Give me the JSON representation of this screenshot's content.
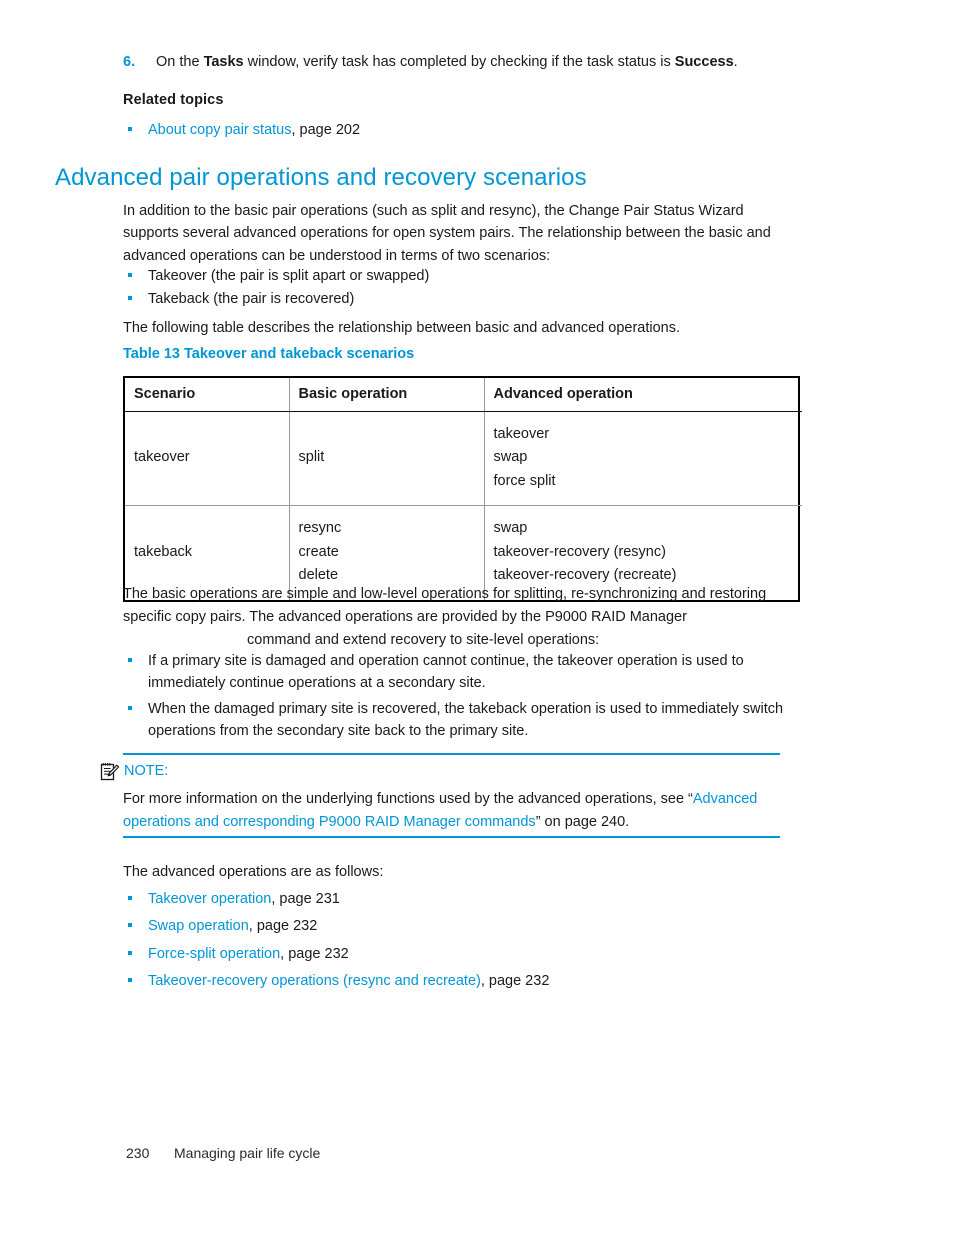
{
  "colors": {
    "accent": "#0096d6",
    "text": "#1a1a1a",
    "table_border": "#000000",
    "table_rule": "#9a9a9a"
  },
  "step": {
    "number": "6.",
    "text_before_bold1": "On the ",
    "bold1": "Tasks",
    "text_middle": " window, verify task has completed by checking if the task status is ",
    "bold2": "Success",
    "text_end": "."
  },
  "related": {
    "heading": "Related topics",
    "items": [
      {
        "link": "About copy pair status",
        "rest": ", page 202"
      }
    ]
  },
  "heading": {
    "title": "Advanced pair operations and recovery scenarios"
  },
  "intro": {
    "paragraph": "In addition to the basic pair operations (such as split and resync), the Change Pair Status Wizard supports several advanced operations for open system pairs. The relationship between the basic and advanced operations can be understood in terms of two scenarios:",
    "scenarios": [
      "Takeover (the pair is split apart or swapped)",
      "Takeback (the pair is recovered)"
    ],
    "table_lead": "The following table describes the relationship between basic and advanced operations."
  },
  "table": {
    "caption_number": "Table 13",
    "caption_title": "Takeover and takeback scenarios",
    "caption_full": "Table 13 Takeover and takeback scenarios",
    "headers": [
      "Scenario",
      "Basic operation",
      "Advanced operation"
    ],
    "rows": [
      {
        "scenario": "takeover",
        "basic": [
          "split"
        ],
        "advanced": [
          "takeover",
          "swap",
          "force split"
        ]
      },
      {
        "scenario": "takeback",
        "basic": [
          "resync",
          "create",
          "delete"
        ],
        "advanced": [
          "swap",
          "takeover-recovery (resync)",
          "takeover-recovery (recreate)"
        ]
      }
    ]
  },
  "post": {
    "paragraph_line1": "The basic operations are simple and low-level operations for splitting, re-synchronizing and restoring specific copy pairs. The advanced operations are provided by the P9000 RAID Manager",
    "paragraph_line2": "command and extend recovery to site-level operations:",
    "bullets": [
      "If a primary site is damaged and operation cannot continue, the takeover operation is used to immediately continue operations at a secondary site.",
      "When the damaged primary site is recovered, the takeback operation is used to immediately switch operations from the secondary site back to the primary site."
    ]
  },
  "note": {
    "icon": "note-pencil-icon",
    "label": "NOTE:",
    "text_before": "For more information on the underlying functions used by the advanced operations, see “",
    "link": "Advanced operations and corresponding P9000 RAID Manager commands",
    "text_after": "” on page 240."
  },
  "closing": {
    "lead": "The advanced operations are as follows:",
    "items": [
      {
        "link": "Takeover operation",
        "rest": ", page 231"
      },
      {
        "link": "Swap operation",
        "rest": ", page 232"
      },
      {
        "link": "Force-split operation",
        "rest": ", page 232"
      },
      {
        "link": "Takeover-recovery operations (resync and recreate)",
        "rest": ", page 232"
      }
    ]
  },
  "footer": {
    "page_number": "230",
    "chapter": "Managing pair life cycle"
  }
}
